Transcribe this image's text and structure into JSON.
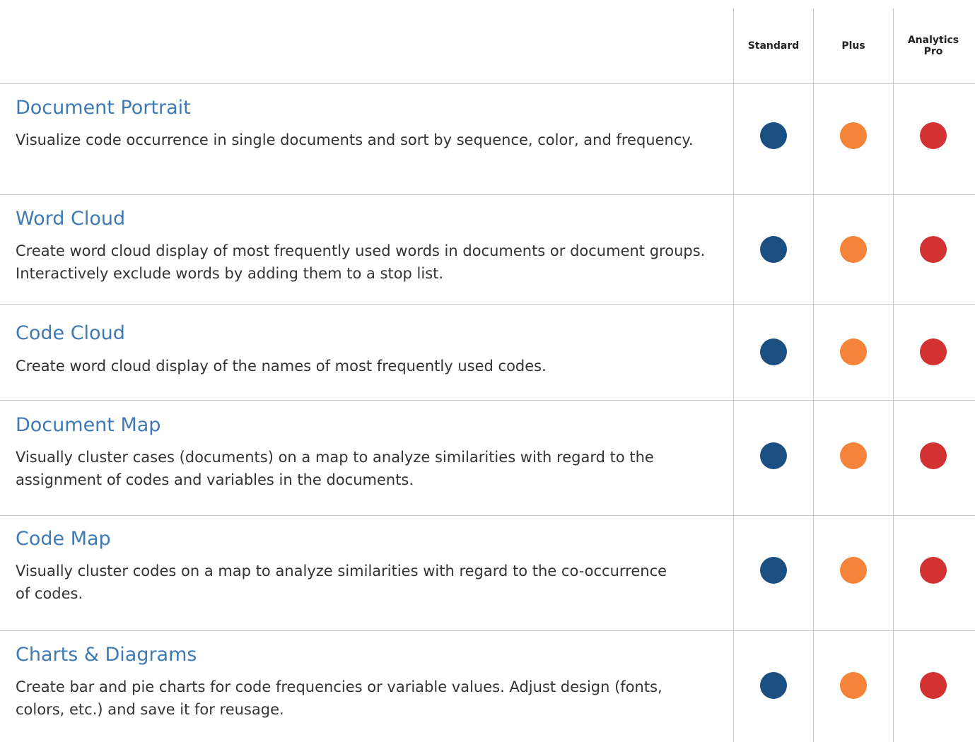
{
  "columns": [
    {
      "label": "Standard",
      "color": "#1b4f82"
    },
    {
      "label": "Plus",
      "color": "#f5843a"
    },
    {
      "label": "Analytics Pro",
      "color": "#d33232"
    }
  ],
  "features": [
    {
      "title": "Document Portrait",
      "description": "Visualize code occurrence in single documents and sort by sequence, color, and frequency.",
      "availability": [
        "included",
        "included",
        "included"
      ]
    },
    {
      "title": "Word Cloud",
      "description": "Create word cloud display of most frequently used words in documents or document groups. Interactively exclude words by adding them to a stop list.",
      "availability": [
        "included",
        "included",
        "included"
      ]
    },
    {
      "title": "Code Cloud",
      "description": "Create word cloud display of the names of most frequently used codes.",
      "availability": [
        "included",
        "included",
        "included"
      ]
    },
    {
      "title": "Document Map",
      "description": "Visually cluster cases (documents) on a map to analyze similarities with regard to the assignment of codes and variables in the documents.",
      "availability": [
        "included",
        "included",
        "included"
      ]
    },
    {
      "title": "Code Map",
      "description": "Visually cluster codes on a map to analyze similarities with regard to the co-occurrence of codes.",
      "availability": [
        "included",
        "included",
        "included"
      ]
    },
    {
      "title": "Charts & Diagrams",
      "description": "Create bar and pie charts for code frequencies or variable values. Adjust design (fonts, colors, etc.) and save it for reusage.",
      "availability": [
        "included",
        "included",
        "included"
      ]
    }
  ]
}
